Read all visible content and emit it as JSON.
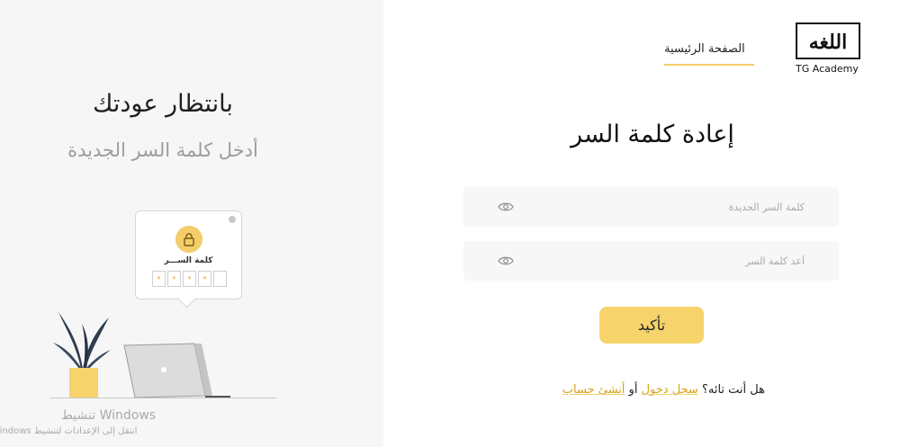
{
  "brand": {
    "logo_text": "TG Academy",
    "accent_color": "#f6d36b"
  },
  "nav": {
    "home_label": "الصفحة الرئيسية"
  },
  "left_panel": {
    "title": "بانتظار عودتك",
    "subtitle": "أدخل كلمة السر الجديدة",
    "illustration": {
      "bubble_label": "كلمة الســـر",
      "pin_masks": [
        "*",
        "*",
        "*",
        "*",
        ""
      ],
      "lock_icon": "lock-icon"
    }
  },
  "form": {
    "title": "إعادة كلمة السر",
    "new_password_placeholder": "كلمة السر الجديدة",
    "repeat_password_placeholder": "أعد كلمة السر",
    "confirm_label": "تأكيد"
  },
  "footer": {
    "question": "هل أنت تائه؟",
    "login_link": "سجل دخول",
    "or": "أو",
    "signup_link": "أنشئ حساب"
  },
  "os_overlay": {
    "activate_title": "تنشيط Windows",
    "activate_sub": "انتقل إلى الإعدادات لتنشيط Windows"
  }
}
